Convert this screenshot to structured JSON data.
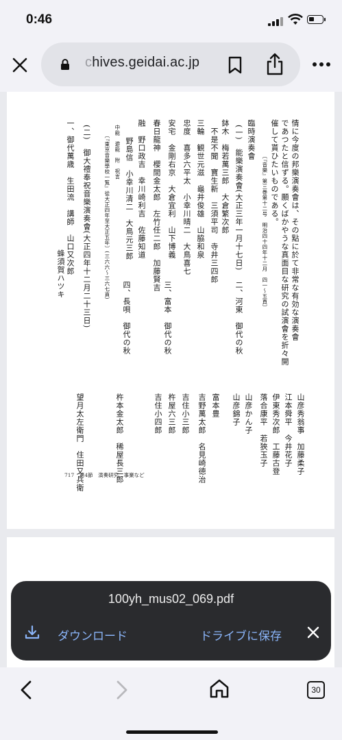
{
  "status": {
    "time": "0:46"
  },
  "toolbar": {
    "url_faded": "c",
    "url_text": "hives.geidai.ac.jp",
    "icons": [
      "close-icon",
      "lock-icon",
      "bookmark-icon",
      "share-icon",
      "more-icon"
    ]
  },
  "document": {
    "columns": [
      "情に今度の邦樂演奏會は、その點に於て非常な有効な演奏會",
      "であつたと信ずる。願くばかやうな真面目な研究の試演會を折々開",
      "催して貰ひたいものである。",
      "〔『音樂』第三巻第十二号　明治四十四年十二月　四一〜五頁〕",
      "臨時演奏會",
      "(一)　能樂演奏會(大正三年一月十七日)",
      "鉢木　梅若萬三郎　大倉繁次郎",
      "不是不聞　寶生新　三須平司　寺井三四郎",
      "三輪　観世元滋　龜井俊雄　山脇和泉",
      "忠度　喜多六平太　小幸川晴二　大鳥喜七",
      "安宅　金剛右京　大倉宜利　山下博義",
      "春日龍神　櫻間金太郎　左竹任二郎　加藤賢吉",
      "融　野口政吉　幸川崎利吉　佐藤知道",
      "野島信　小幸川清二　大鳥元三郎",
      "中能　遊能　附　祝言",
      "〔『東京音樂學校一覧』從大正四年至大正五年〕(三六六〜三六七頁)",
      "(二)　御大禮奉祝音樂演奏會(大正四年十二月二十三日)",
      "一、御代萬歳　生田流　講師　山口又次郎",
      "蜂須賀ハツキ"
    ],
    "right_block": [
      "二、河東　御代の秋",
      "三、富本　御代の秋",
      "四、長唄　御代の秋"
    ],
    "lower_block": [
      "山彦秀翁事　加藤柔子",
      "江本舜平　今井花子",
      "伊東秀次郎　工藤古登",
      "落合康平　若狹玉子",
      "山彦かん子",
      "山彦錦子",
      "富本豊",
      "吉野萬太郎　名見崎德治",
      "吉住小三郎",
      "杵屋六三郎",
      "吉住小四郎",
      "杵本金太郎　稀屋長三郎",
      "望月太左衛門　住田又兵衛"
    ],
    "footer": "717　第4節　演奏研究、事業など"
  },
  "download_sheet": {
    "filename": "100yh_mus02_069.pdf",
    "download_label": "ダウンロード",
    "drive_label": "ドライブに保存"
  },
  "bottom_nav": {
    "tabs_count": "30"
  }
}
